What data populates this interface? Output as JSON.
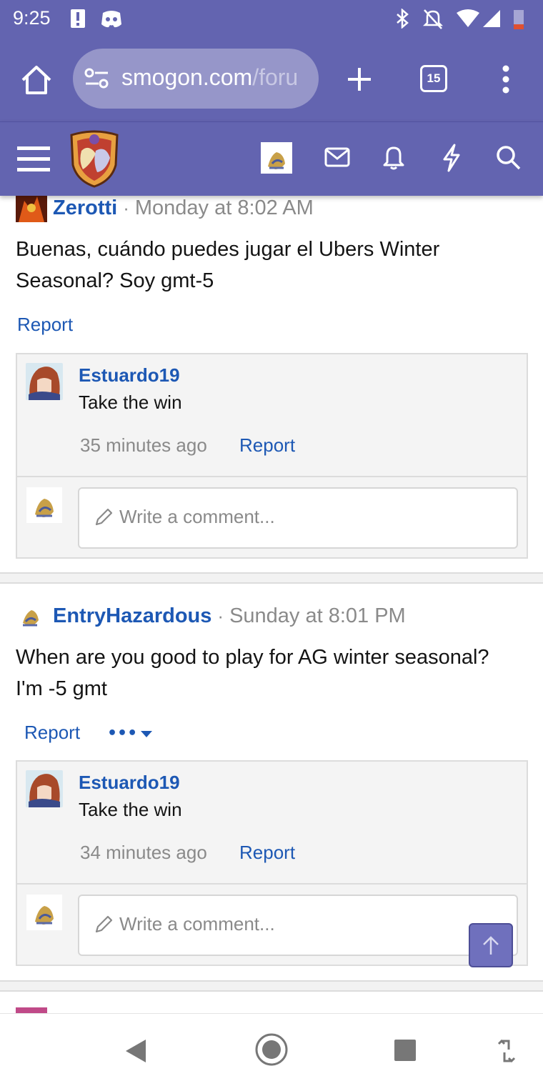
{
  "status_bar": {
    "time": "9:25",
    "icons": [
      "alert-notification-icon",
      "discord-icon",
      "bluetooth-icon",
      "mute-icon",
      "wifi-icon",
      "signal-icon",
      "battery-icon"
    ]
  },
  "browser": {
    "url_main": "smogon.com",
    "url_rest": "/foru",
    "tab_count": "15",
    "icons": [
      "home-icon",
      "site-settings-icon",
      "new-tab-icon",
      "tab-switcher-icon",
      "menu-icon"
    ]
  },
  "site_bar": {
    "icons": [
      "hamburger-icon",
      "smogon-logo",
      "user-avatar",
      "inbox-icon",
      "bell-icon",
      "bolt-icon",
      "search-icon"
    ]
  },
  "posts": [
    {
      "username": "Zerotti",
      "sep": "·",
      "date": "Monday at 8:02 AM",
      "body_line1": "Buenas, cuándo puedes jugar el Ubers Winter",
      "body_line2": "Seasonal? Soy gmt-5",
      "report": "Report",
      "comments": [
        {
          "username": "Estuardo19",
          "text": "Take the win",
          "time": "35 minutes ago",
          "report": "Report"
        }
      ],
      "comment_placeholder": "Write a comment..."
    },
    {
      "username": "EntryHazardous",
      "sep": "·",
      "date": "Sunday at 8:01 PM",
      "body_line1": "When are you good to play for AG winter seasonal?",
      "body_line2": "I'm -5 gmt",
      "report": "Report",
      "more": "•••",
      "comments": [
        {
          "username": "Estuardo19",
          "text": "Take the win",
          "time": "34 minutes ago",
          "report": "Report"
        }
      ],
      "comment_placeholder": "Write a comment..."
    }
  ],
  "colors": {
    "brand": "#6364b0",
    "link": "#1d58b4",
    "muted": "#8a8a8a"
  },
  "nav_bar": {
    "icons": [
      "back-icon",
      "home-icon",
      "recents-icon",
      "rotate-icon"
    ]
  }
}
